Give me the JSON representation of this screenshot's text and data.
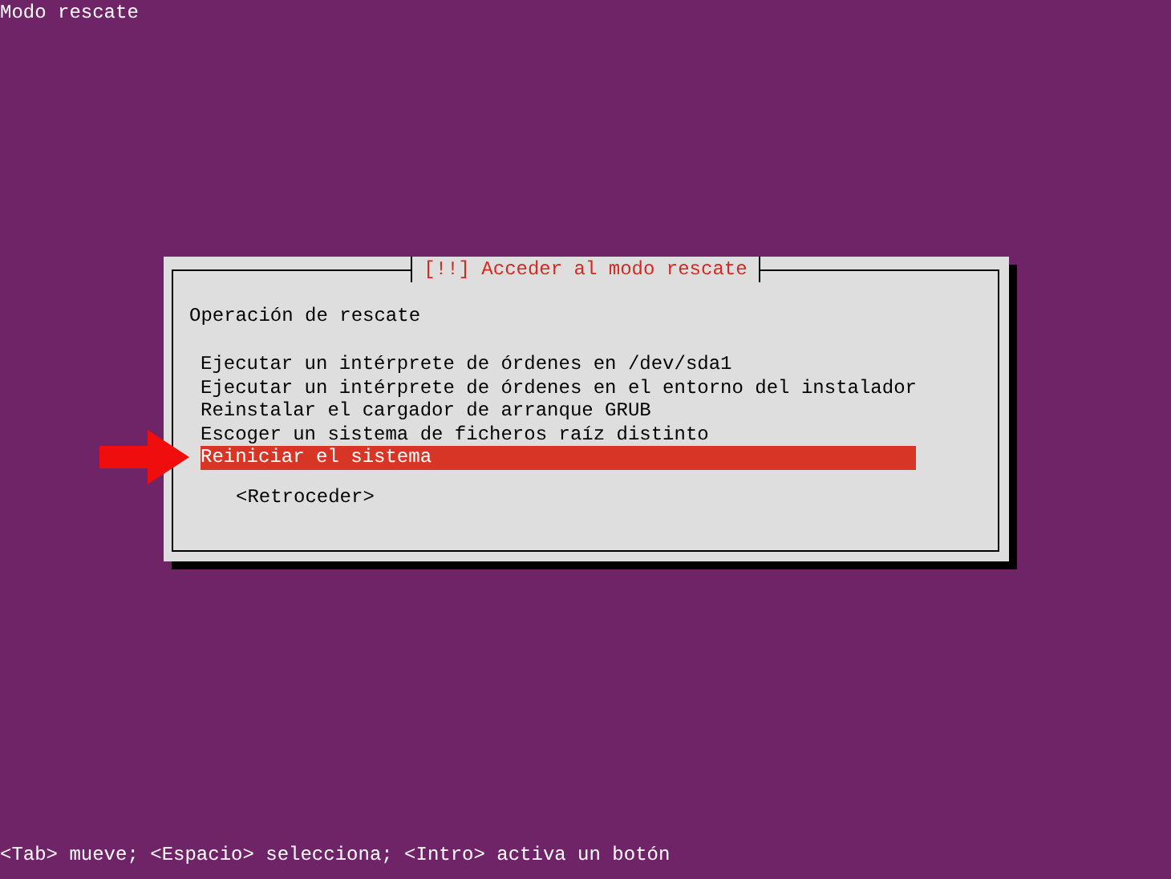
{
  "screen_title": "Modo rescate",
  "dialog": {
    "title": "[!!] Acceder al modo rescate",
    "prompt": "Operación de rescate",
    "items": [
      {
        "label": "Ejecutar un intérprete de órdenes en /dev/sda1",
        "selected": false
      },
      {
        "label": "Ejecutar un intérprete de órdenes en el entorno del instalador",
        "selected": false
      },
      {
        "label": "Reinstalar el cargador de arranque GRUB",
        "selected": false
      },
      {
        "label": "Escoger un sistema de ficheros raíz distinto",
        "selected": false
      },
      {
        "label": "Reiniciar el sistema",
        "selected": true
      }
    ],
    "back_button": "<Retroceder>"
  },
  "status_bar": "<Tab> mueve; <Espacio> selecciona; <Intro> activa un botón"
}
